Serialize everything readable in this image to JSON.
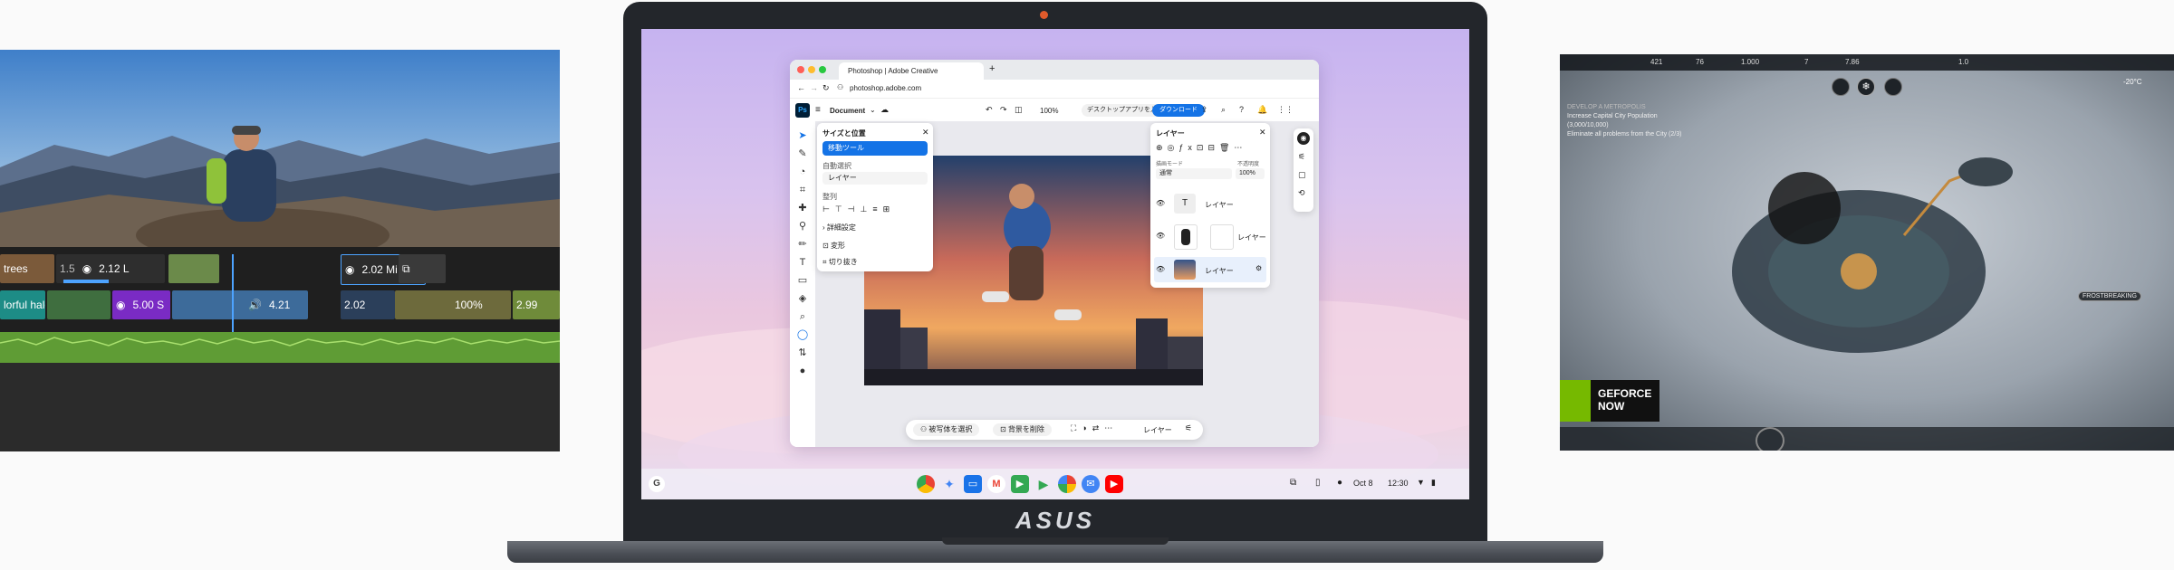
{
  "left_editor": {
    "clip_labels": [
      "trees",
      "1.5",
      "2.12 L",
      "2.02 Mi",
      "lorful halo",
      "5.00 S",
      "4.21",
      "2.02",
      "100%",
      "2.99"
    ],
    "colors": {
      "accent_blue": "#4da3ff",
      "purple": "#7a2bc4",
      "teal": "#1d8c86",
      "waveform": "#7fc24f"
    }
  },
  "photoshop": {
    "tab_title": "Photoshop | Adobe Creative",
    "new_tab": "+",
    "url": "photoshop.adobe.com",
    "ps_logo": "Ps",
    "document": "Document",
    "zoom": "100%",
    "desktop_btn": "デスクトップアプリを入手",
    "download_btn": "ダウンロード",
    "size_panel": {
      "title": "サイズと位置",
      "selected_tool": "移動ツール",
      "auto_select_label": "自動選択",
      "auto_select_value": "レイヤー",
      "align_label": "整列",
      "details": "詳細設定",
      "transform": "変形",
      "crop": "切り抜き"
    },
    "layers_panel": {
      "title": "レイヤー",
      "blend_label": "描画モード",
      "blend_value": "通常",
      "opacity_label": "不透明度",
      "opacity_value": "100%",
      "layers": [
        "レイヤー",
        "レイヤー",
        "レイヤー"
      ]
    },
    "bottom_bar": {
      "select_subject": "被写体を選択",
      "remove_bg": "背景を削除",
      "layer": "レイヤー"
    }
  },
  "shelf": {
    "launcher": "G",
    "date": "Oct 8",
    "time": "12:30"
  },
  "laptop": {
    "brand": "ASUS"
  },
  "game": {
    "top_stats": [
      "421",
      "76",
      "1.000",
      "7",
      "7.86",
      "1.0"
    ],
    "objective_header": "DEVELOP A METROPOLIS",
    "objective_1": "Increase Capital City Population",
    "objective_1_count": "(3,000/10,000)",
    "objective_2": "Eliminate all problems from the City (2/3)",
    "temperature": "-20°C",
    "badge_label": "FROSTBREAKING",
    "geforce": [
      "GEFORCE",
      "NOW"
    ]
  }
}
